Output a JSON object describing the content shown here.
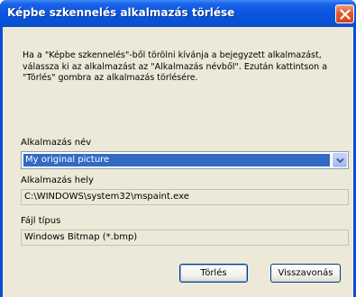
{
  "window": {
    "title": "Képbe szkennelés alkalmazás törlése"
  },
  "description": "Ha a \"Képbe szkennelés\"-ből törölni kívánja a bejegyzett alkalmazást, válassza ki az alkalmazást az \"Alkalmazás névből\". Ezután kattintson a \"Törlés\" gombra az alkalmazás törlésére.",
  "fields": {
    "app_name_label": "Alkalmazás név",
    "app_name_value": "My original picture",
    "app_location_label": "Alkalmazás hely",
    "app_location_value": "C:\\WINDOWS\\system32\\mspaint.exe",
    "file_type_label": "Fájl típus",
    "file_type_value": "Windows Bitmap (*.bmp)"
  },
  "buttons": {
    "delete_label": "Törlés",
    "cancel_label": "Visszavonás"
  },
  "icons": {
    "close": "close-icon",
    "dropdown": "chevron-down-icon"
  },
  "colors": {
    "titlebar": "#0851d8",
    "selection": "#316ac5",
    "dialog_bg": "#ece9d8",
    "close_button": "#e4582e"
  }
}
